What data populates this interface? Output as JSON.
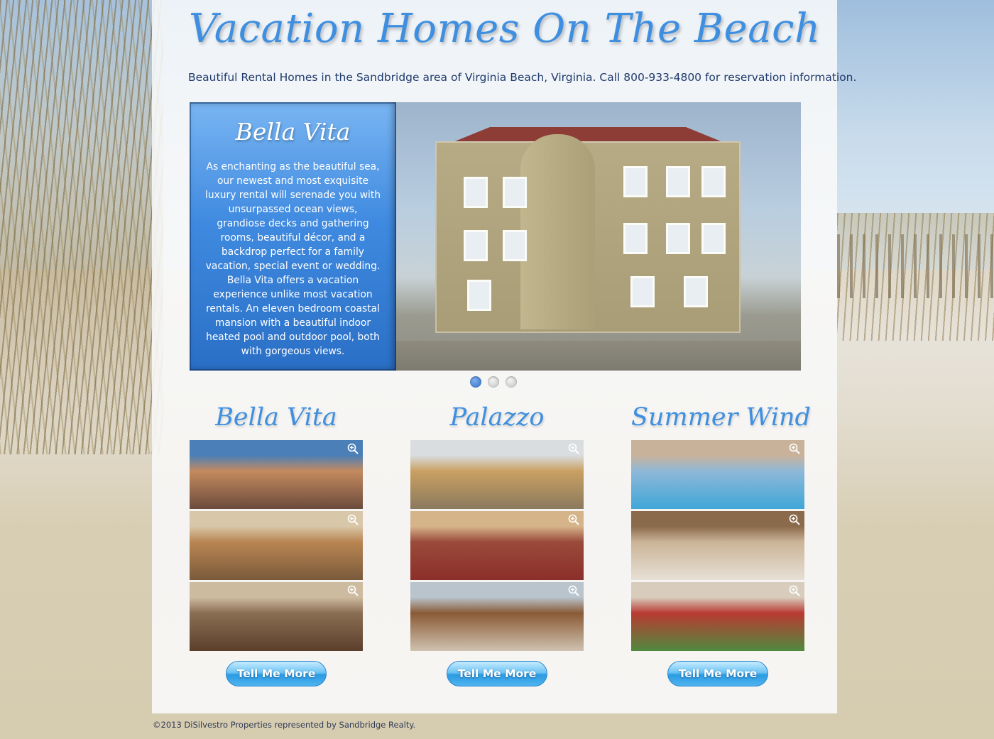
{
  "site_title": "Vacation Homes On The Beach",
  "tagline": "Beautiful Rental Homes in the Sandbridge area of Virginia Beach, Virginia. Call 800-933-4800 for reservation information.",
  "slider": {
    "title": "Bella Vita",
    "text": "As enchanting as the beautiful sea, our newest and most exquisite luxury rental will serenade you with unsurpassed ocean views, grandiose decks and gathering rooms, beautiful décor, and a backdrop perfect for a family vacation, special event or wedding. Bella Vita offers a vacation experience unlike most vacation rentals. An eleven bedroom coastal mansion with a beautiful indoor heated pool and outdoor pool, both with gorgeous views.",
    "active_slide": 1,
    "slide_count": 3
  },
  "properties": [
    {
      "name": "Bella Vita",
      "button": "Tell Me More",
      "thumb_colors": [
        [
          "#c48a5e",
          "#6b4b3c",
          "#4a7fb8"
        ],
        [
          "#b98552",
          "#7a5a3b",
          "#d8c7a8"
        ],
        [
          "#8a6e52",
          "#5b3f2c",
          "#cdbba0"
        ]
      ]
    },
    {
      "name": "Palazzo",
      "button": "Tell Me More",
      "thumb_colors": [
        [
          "#caa062",
          "#8a7a5e",
          "#d9dde0"
        ],
        [
          "#9a4a3a",
          "#8b2f2a",
          "#d6b48a"
        ],
        [
          "#8a5a35",
          "#cfc2b0",
          "#b9c4cc"
        ]
      ]
    },
    {
      "name": "Summer Wind",
      "button": "Tell Me More",
      "thumb_colors": [
        [
          "#8fb8d8",
          "#3fa6d8",
          "#c9b29a"
        ],
        [
          "#cbb497",
          "#e6e0d6",
          "#8a6a4a"
        ],
        [
          "#b93a32",
          "#4f8a3e",
          "#d8cdbd"
        ]
      ]
    }
  ],
  "footer": "©2013 DiSilvestro Properties represented by Sandbridge Realty.",
  "colors": {
    "accent": "#3f8fe0",
    "caption_blue": "#2a6fc6",
    "button_blue": "#2b9be2",
    "sand": "#d9cfb6"
  }
}
